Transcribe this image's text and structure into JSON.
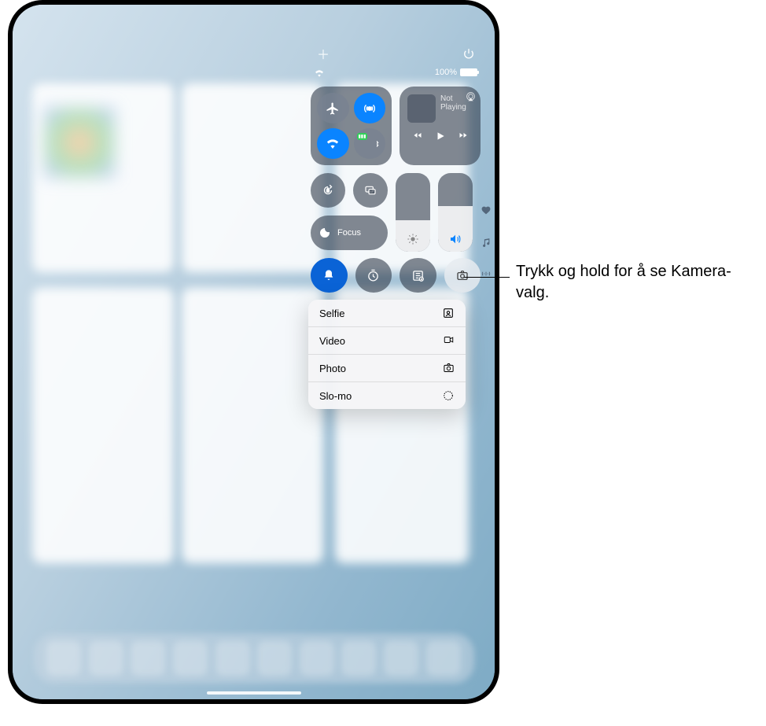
{
  "callout": {
    "text": "Trykk og hold for å se Kamera-valg."
  },
  "status": {
    "battery_percent": "100%"
  },
  "media": {
    "title": "Not Playing"
  },
  "focus": {
    "label": "Focus"
  },
  "context_menu": {
    "items": [
      {
        "label": "Selfie",
        "icon": "selfie-icon"
      },
      {
        "label": "Video",
        "icon": "video-icon"
      },
      {
        "label": "Photo",
        "icon": "photo-icon"
      },
      {
        "label": "Slo-mo",
        "icon": "slomo-icon"
      }
    ]
  },
  "sliders": {
    "brightness_fill": "40%",
    "volume_fill": "58%"
  },
  "colors": {
    "accent_blue": "#0a84ff",
    "accent_green": "#30d158"
  }
}
